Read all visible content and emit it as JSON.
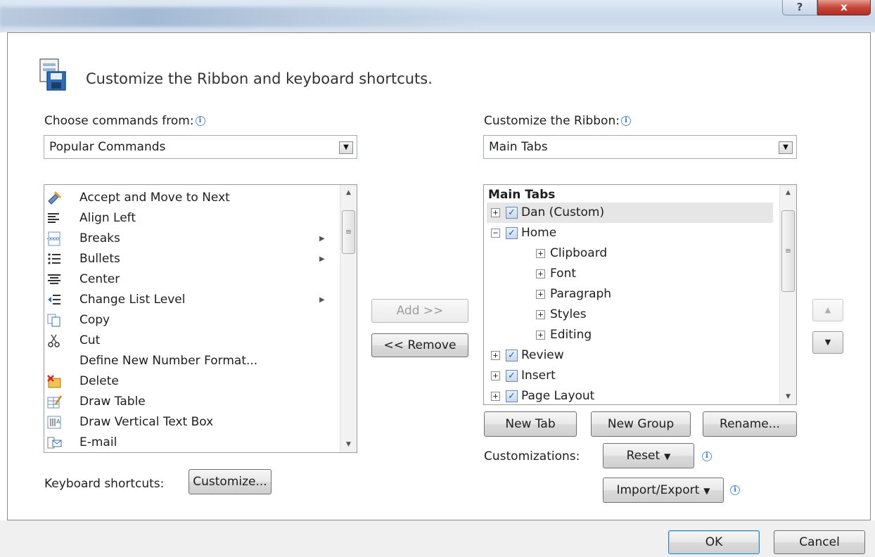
{
  "window": {
    "help_label": "?",
    "close_label": "x"
  },
  "header": {
    "title": "Customize the Ribbon and keyboard shortcuts."
  },
  "left": {
    "choose_label": "Choose commands from:",
    "choose_value": "Popular Commands",
    "commands": [
      {
        "label": "Accept and Move to Next",
        "icon": "accept-icon",
        "submenu": false
      },
      {
        "label": "Align Left",
        "icon": "align-left-icon",
        "submenu": false
      },
      {
        "label": "Breaks",
        "icon": "breaks-icon",
        "submenu": true
      },
      {
        "label": "Bullets",
        "icon": "bullets-icon",
        "submenu": true
      },
      {
        "label": "Center",
        "icon": "center-icon",
        "submenu": false
      },
      {
        "label": "Change List Level",
        "icon": "list-level-icon",
        "submenu": true
      },
      {
        "label": "Copy",
        "icon": "copy-icon",
        "submenu": false
      },
      {
        "label": "Cut",
        "icon": "cut-icon",
        "submenu": false
      },
      {
        "label": "Define New Number Format...",
        "icon": "",
        "submenu": false
      },
      {
        "label": "Delete",
        "icon": "delete-icon",
        "submenu": false
      },
      {
        "label": "Draw Table",
        "icon": "draw-table-icon",
        "submenu": false
      },
      {
        "label": "Draw Vertical Text Box",
        "icon": "vertical-text-box-icon",
        "submenu": false
      },
      {
        "label": "E-mail",
        "icon": "email-icon",
        "submenu": false
      }
    ],
    "keyboard_label": "Keyboard shortcuts:",
    "customize_button": "Customize..."
  },
  "middle": {
    "add_button": "Add >>",
    "remove_button": "<< Remove"
  },
  "right": {
    "ribbon_label": "Customize the Ribbon:",
    "ribbon_value": "Main Tabs",
    "tree_header": "Main Tabs",
    "tree": [
      {
        "label": "Dan (Custom)",
        "level": 0,
        "expander": "+",
        "checked": true,
        "selected": true
      },
      {
        "label": "Home",
        "level": 0,
        "expander": "−",
        "checked": true,
        "selected": false
      },
      {
        "label": "Clipboard",
        "level": 1,
        "expander": "+",
        "checked": false,
        "selected": false
      },
      {
        "label": "Font",
        "level": 1,
        "expander": "+",
        "checked": false,
        "selected": false
      },
      {
        "label": "Paragraph",
        "level": 1,
        "expander": "+",
        "checked": false,
        "selected": false
      },
      {
        "label": "Styles",
        "level": 1,
        "expander": "+",
        "checked": false,
        "selected": false
      },
      {
        "label": "Editing",
        "level": 1,
        "expander": "+",
        "checked": false,
        "selected": false
      },
      {
        "label": "Review",
        "level": 0,
        "expander": "+",
        "checked": true,
        "selected": false
      },
      {
        "label": "Insert",
        "level": 0,
        "expander": "+",
        "checked": true,
        "selected": false
      },
      {
        "label": "Page Layout",
        "level": 0,
        "expander": "+",
        "checked": true,
        "selected": false
      }
    ],
    "new_tab_button": "New Tab",
    "new_group_button": "New Group",
    "rename_button": "Rename...",
    "customizations_label": "Customizations:",
    "reset_button": "Reset",
    "import_export_button": "Import/Export"
  },
  "footer": {
    "ok_button": "OK",
    "cancel_button": "Cancel"
  }
}
